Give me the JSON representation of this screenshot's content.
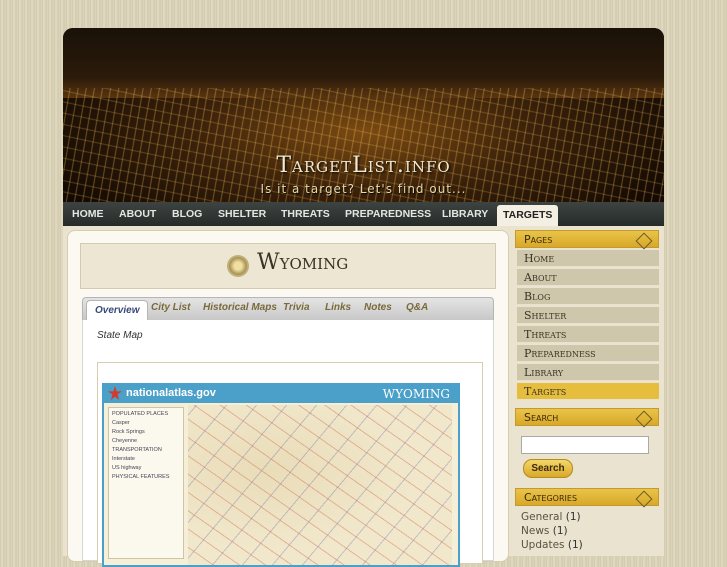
{
  "site": {
    "title": "TargetList.info",
    "tagline": "Is it a target? Let's find out..."
  },
  "nav": [
    "Home",
    "About",
    "Blog",
    "Shelter",
    "Threats",
    "Preparedness",
    "Library",
    "Targets"
  ],
  "page": {
    "title": "Wyoming"
  },
  "tabs": [
    "Overview",
    "City List",
    "Historical Maps",
    "Trivia",
    "Links",
    "Notes",
    "Q&A"
  ],
  "panel": {
    "label": "State Map"
  },
  "map": {
    "brand": "nationalatlas.gov",
    "state": "WYOMING",
    "legend": [
      "POPULATED PLACES",
      "Casper",
      "Rock Springs",
      "Cheyenne",
      "TRANSPORTATION",
      "Interstate",
      "US highway",
      "PHYSICAL FEATURES"
    ]
  },
  "sidebar": {
    "pages_head": "Pages",
    "pages": [
      "Home",
      "About",
      "Blog",
      "Shelter",
      "Threats",
      "Preparedness",
      "Library",
      "Targets"
    ],
    "search_head": "Search",
    "search_button": "Search",
    "categories_head": "Categories",
    "categories": [
      {
        "name": "General",
        "count": "(1)"
      },
      {
        "name": "News",
        "count": "(1)"
      },
      {
        "name": "Updates",
        "count": "(1)"
      }
    ]
  }
}
